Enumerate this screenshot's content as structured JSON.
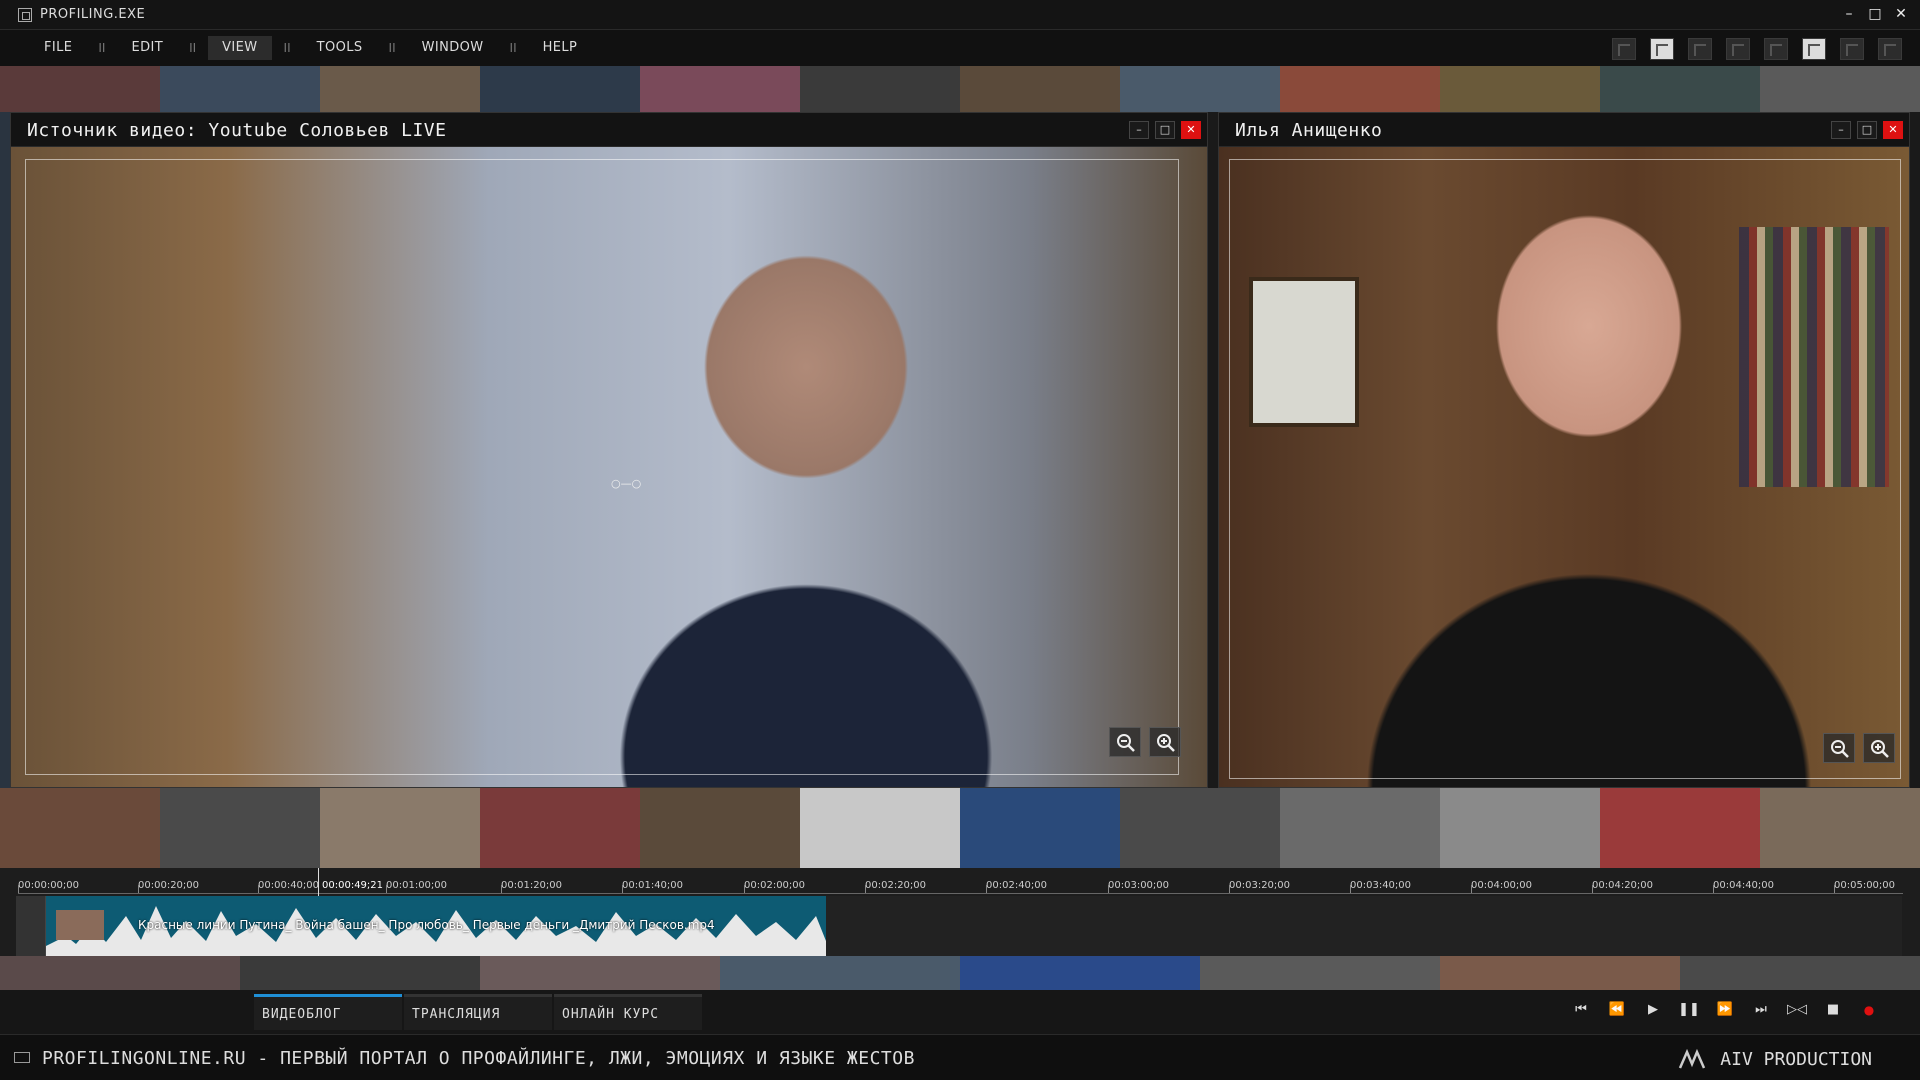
{
  "titlebar": {
    "title": "PROFILING.EXE"
  },
  "menu": {
    "items": [
      "FILE",
      "EDIT",
      "VIEW",
      "TOOLS",
      "WINDOW",
      "HELP"
    ],
    "separator": "II",
    "active": "VIEW"
  },
  "window_left": {
    "title": "Источник видео: Youtube Соловьев LIVE"
  },
  "window_right": {
    "title": "Илья Анищенко"
  },
  "timeline": {
    "ticks": [
      "00:00:00;00",
      "00:00:20;00",
      "00:00:40;00",
      "00:01:00;00",
      "00:01:20;00",
      "00:01:40;00",
      "00:02:00;00",
      "00:02:20;00",
      "00:02:40;00",
      "00:03:00;00",
      "00:03:20;00",
      "00:03:40;00",
      "00:04:00;00",
      "00:04:20;00",
      "00:04:40;00",
      "00:05:00;00"
    ],
    "playhead": "00:00:49;21",
    "clip_label": "Красные линии Путина_ Война башен_ Про любовь_ Первые деньги _Дмитрий Песков.mp4"
  },
  "tabs": [
    {
      "label": "ВИДЕОБЛОГ",
      "active": true
    },
    {
      "label": "ТРАНСЛЯЦИЯ",
      "active": false
    },
    {
      "label": "ОНЛАЙН КУРС",
      "active": false
    }
  ],
  "transport": [
    "skip-start-icon",
    "rewind-icon",
    "play-icon",
    "pause-icon",
    "fast-forward-icon",
    "skip-end-icon",
    "frame-step-icon",
    "stop-icon",
    "record-icon"
  ],
  "status": {
    "text": "PROFILINGONLINE.RU - ПЕРВЫЙ ПОРТАЛ О ПРОФАЙЛИНГЕ, ЛЖИ, ЭМОЦИЯХ И ЯЗЫКЕ ЖЕСТОВ",
    "brand": "AIV PRODUCTION"
  },
  "colors": {
    "accent_tab": "#1f8fd6",
    "close_button": "#dd1111",
    "clip": "#0d5b73",
    "record": "#e01010"
  }
}
